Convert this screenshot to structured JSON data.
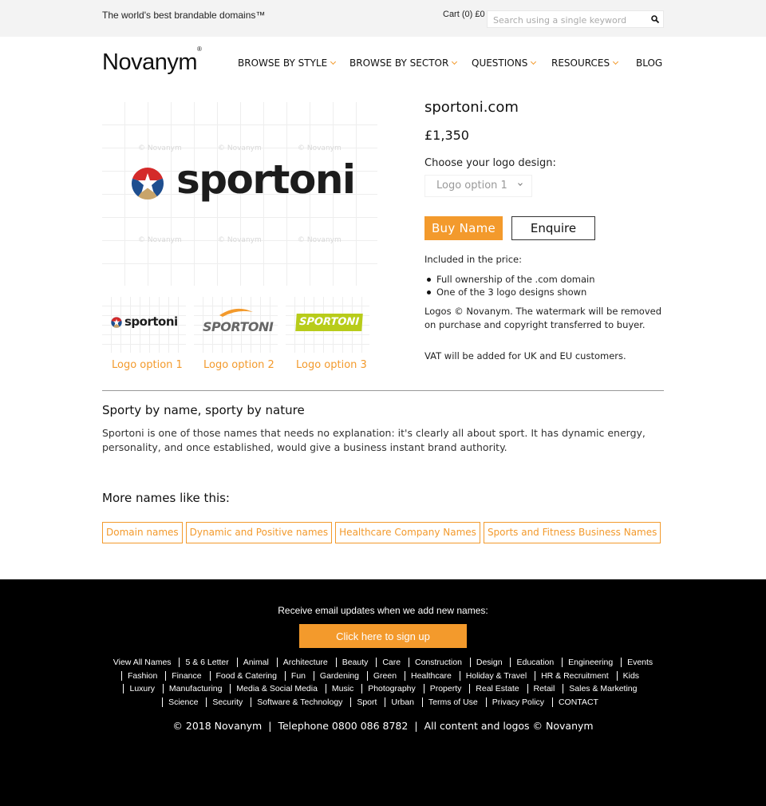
{
  "topbar": {
    "tagline": "The world's best brandable domains™",
    "cart": "Cart (0) £0",
    "search_placeholder": "Search using a single keyword"
  },
  "header": {
    "logo_text": "Novanym",
    "logo_mark": "®",
    "nav": [
      {
        "label": "BROWSE BY STYLE",
        "dropdown": true
      },
      {
        "label": "BROWSE BY SECTOR",
        "dropdown": true
      },
      {
        "label": "QUESTIONS",
        "dropdown": true
      },
      {
        "label": "RESOURCES",
        "dropdown": true
      },
      {
        "label": "BLOG",
        "dropdown": false
      }
    ]
  },
  "product": {
    "brand_word": "sportoni",
    "watermark": "© Novanym",
    "thumbnails": [
      {
        "label": "Logo option 1",
        "mark": "sportoni"
      },
      {
        "label": "Logo option 2",
        "mark": "SPORTONI"
      },
      {
        "label": "Logo option 3",
        "mark": "SPORTONI"
      }
    ],
    "domain": "sportoni.com",
    "price": "£1,350",
    "choose_label": "Choose your logo design:",
    "selected_option": "Logo option 1",
    "buy_label": "Buy Name",
    "enquire_label": "Enquire",
    "included_label": "Included in the price:",
    "included_items": [
      "Full ownership of the .com domain",
      "One of the 3 logo designs shown"
    ],
    "logos_note": "Logos © Novanym. The watermark will be removed on purchase and copyright transferred to buyer.",
    "vat_note": "VAT will be added for UK and EU customers."
  },
  "about": {
    "heading": "Sporty by name, sporty by nature",
    "description": "Sportoni is one of those names that needs no explanation: it's clearly all about sport. It has dynamic energy, personality, and once established, would give a business instant brand authority."
  },
  "more": {
    "heading": "More names like this:",
    "tags": [
      "Domain names",
      "Dynamic and Positive names",
      "Healthcare Company Names",
      "Sports and Fitness Business Names"
    ]
  },
  "footer": {
    "receive": "Receive email updates when we add new names:",
    "signup_label": "Click here to sign up",
    "links": [
      "View All Names",
      "5 & 6 Letter",
      "Animal",
      "Architecture",
      "Beauty",
      "Care",
      "Construction",
      "Design",
      "Education",
      "Engineering",
      "Events",
      "Fashion",
      "Finance",
      "Food & Catering",
      "Fun",
      "Gardening",
      "Green",
      "Healthcare",
      "Holiday & Travel",
      "HR & Recruitment",
      "Kids",
      "Luxury",
      "Manufacturing",
      "Media & Social Media",
      "Music",
      "Photography",
      "Property",
      "Real Estate",
      "Retail",
      "Sales & Marketing",
      "Science",
      "Security",
      "Software & Technology",
      "Sport",
      "Urban",
      "Terms of Use",
      "Privacy Policy",
      "CONTACT"
    ],
    "copyright": "© 2018 Novanym",
    "telephone": "Telephone 0800 086 8782",
    "rights": "All content and logos © Novanym"
  },
  "colors": {
    "accent": "#f39a2c",
    "footer_bg": "#000000",
    "topbar_bg": "#f3f3f3"
  }
}
